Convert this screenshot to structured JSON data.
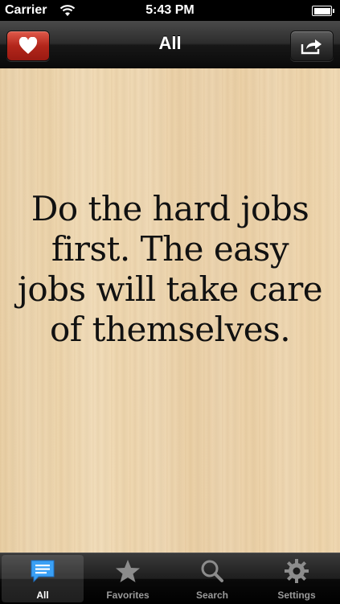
{
  "status_bar": {
    "carrier": "Carrier",
    "time": "5:43 PM"
  },
  "nav": {
    "title": "All"
  },
  "quote": {
    "text": "Do the hard jobs first. The easy jobs will take care of themselves."
  },
  "tabs": [
    {
      "label": "All",
      "icon": "speech-bubble-icon",
      "selected": true
    },
    {
      "label": "Favorites",
      "icon": "star-icon"
    },
    {
      "label": "Search",
      "icon": "magnifier-icon"
    },
    {
      "label": "Settings",
      "icon": "gear-icon"
    }
  ],
  "colors": {
    "favorite_button": "#c0392b",
    "tab_selected_icon": "#2a8ff0"
  }
}
